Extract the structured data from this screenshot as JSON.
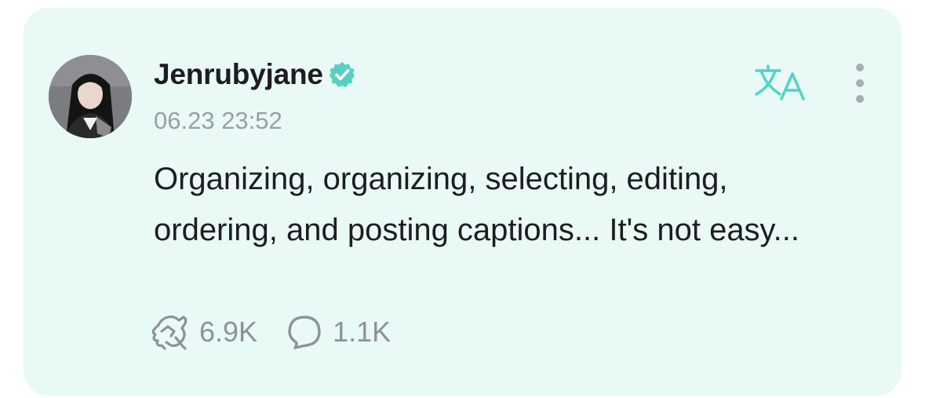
{
  "post": {
    "username": "Jenrubyjane",
    "verified": true,
    "timestamp": "06.23 23:52",
    "text": "Organizing, organizing, selecting, editing, ordering, and posting captions... It's not easy...",
    "likes": "6.9K",
    "comments": "1.1K"
  },
  "icons": {
    "verified": "verified-badge-icon",
    "translate": "translate-icon",
    "more": "more-vertical-icon",
    "like": "heart-hands-icon",
    "comment": "comment-bubble-icon"
  },
  "colors": {
    "card_background": "#e8f9f6",
    "accent": "#4fd2c6",
    "text": "#1d1d1f",
    "muted": "#9a9ea3"
  }
}
